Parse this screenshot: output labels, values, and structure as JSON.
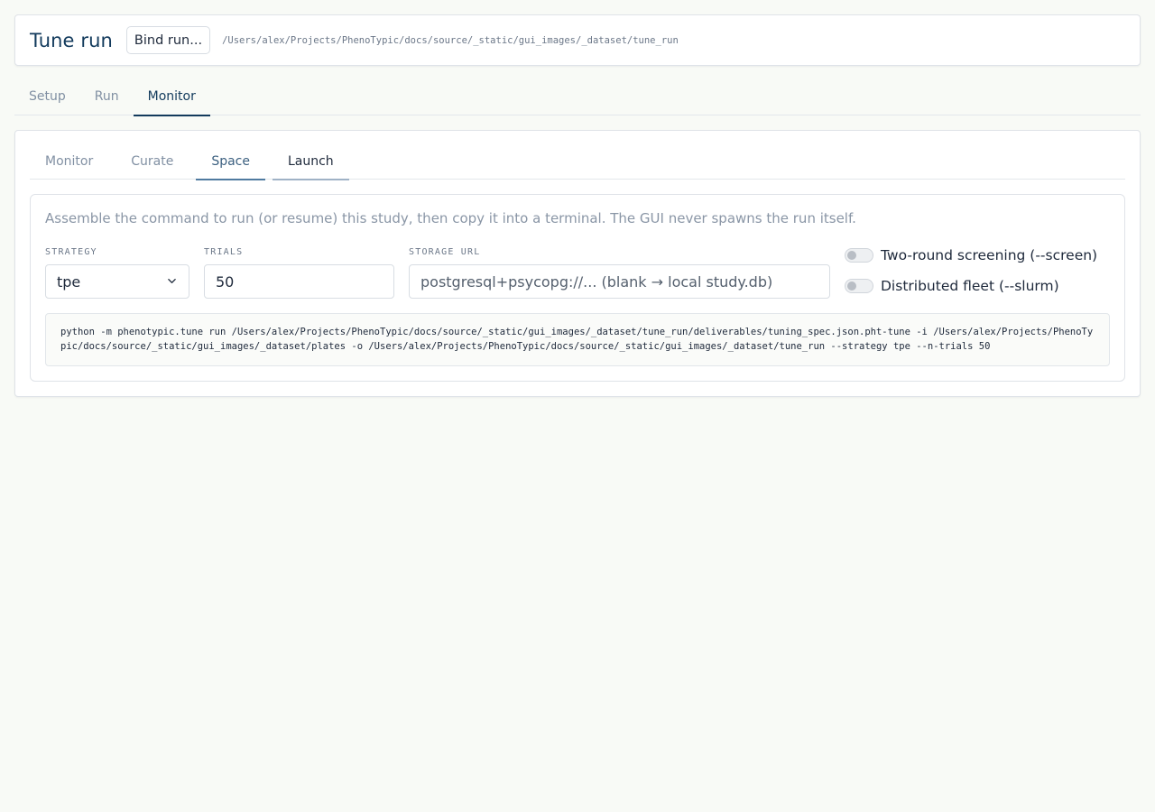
{
  "header": {
    "title": "Tune run",
    "bind_button_label": "Bind run...",
    "run_path": "/Users/alex/Projects/PhenoTypic/docs/source/_static/gui_images/_dataset/tune_run"
  },
  "top_tabs": [
    {
      "label": "Setup",
      "active": false
    },
    {
      "label": "Run",
      "active": false
    },
    {
      "label": "Monitor",
      "active": true
    }
  ],
  "sub_tabs": [
    {
      "label": "Monitor",
      "state": "inactive"
    },
    {
      "label": "Curate",
      "state": "inactive"
    },
    {
      "label": "Space",
      "state": "selected"
    },
    {
      "label": "Launch",
      "state": "active"
    }
  ],
  "launch": {
    "description": "Assemble the command to run (or resume) this study, then copy it into a terminal. The GUI never spawns the run itself.",
    "strategy": {
      "label": "STRATEGY",
      "value": "tpe"
    },
    "trials": {
      "label": "TRIALS",
      "value": "50"
    },
    "storage": {
      "label": "STORAGE URL",
      "value": "",
      "placeholder": "postgresql+psycopg://... (blank → local study.db)"
    },
    "toggles": [
      {
        "label": "Two-round screening (--screen)",
        "on": false
      },
      {
        "label": "Distributed fleet (--slurm)",
        "on": false
      }
    ],
    "command": "python -m phenotypic.tune run /Users/alex/Projects/PhenoTypic/docs/source/_static/gui_images/_dataset/tune_run/deliverables/tuning_spec.json.pht-tune -i /Users/alex/Projects/PhenoTypic/docs/source/_static/gui_images/_dataset/plates -o /Users/alex/Projects/PhenoTypic/docs/source/_static/gui_images/_dataset/tune_run --strategy tpe --n-trials 50"
  }
}
